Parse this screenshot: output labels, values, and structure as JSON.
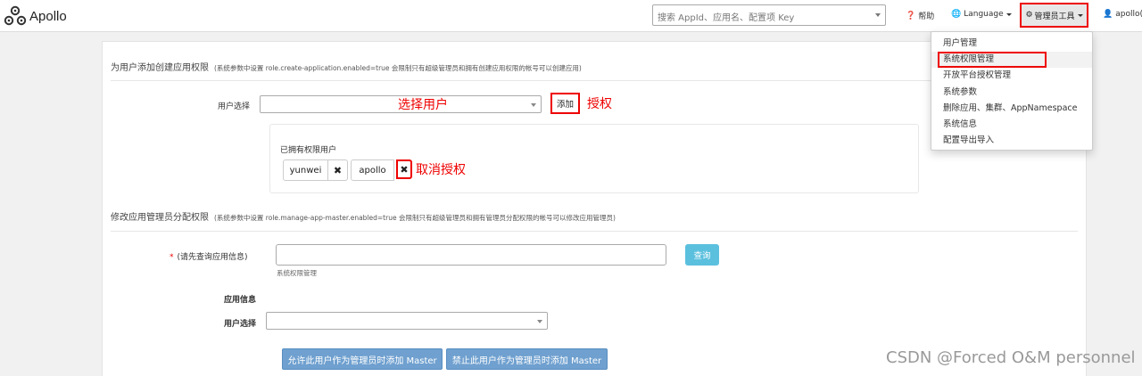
{
  "nav": {
    "brand": "Apollo",
    "search_placeholder": "搜索 AppId、应用名、配置项 Key",
    "help": "帮助",
    "language": "Language",
    "admin_tools": "管理员工具",
    "user": "apollo(a"
  },
  "dropdown": {
    "items": [
      "用户管理",
      "系统权限管理",
      "开放平台授权管理",
      "系统参数",
      "删除应用、集群、AppNamespace",
      "系统信息",
      "配置导出导入"
    ],
    "active_index": 1
  },
  "section1": {
    "title": "为用户添加创建应用权限",
    "note": "(系统参数中设置 role.create-application.enabled=true 会限制只有超级管理员和拥有创建应用权限的帐号可以创建应用)",
    "user_select_label": "用户选择",
    "user_select_note": "选择用户",
    "add_button": "添加",
    "add_note": "授权",
    "owned_label": "已拥有权限用户",
    "users": [
      "yunwei",
      "apollo"
    ],
    "revoke_note": "取消授权"
  },
  "section2": {
    "title": "修改应用管理员分配权限",
    "note": "(系统参数中设置 role.manage-app-master.enabled=true 会限制只有超级管理员和拥有管理员分配权限的帐号可以修改应用管理员)",
    "required_mark": "*",
    "app_label": "(请先查询应用信息)",
    "query_button": "查询",
    "hint": "系统权限管理",
    "app_info_label": "应用信息",
    "user_select_label": "用户选择",
    "allow_button": "允许此用户作为管理员时添加 Master",
    "forbid_button": "禁止此用户作为管理员时添加 Master"
  },
  "watermark": "CSDN @Forced O&M personnel",
  "colors": {
    "highlight": "#ee0000",
    "query_button": "#5bc0de",
    "action_button": "#6fa0cf"
  }
}
